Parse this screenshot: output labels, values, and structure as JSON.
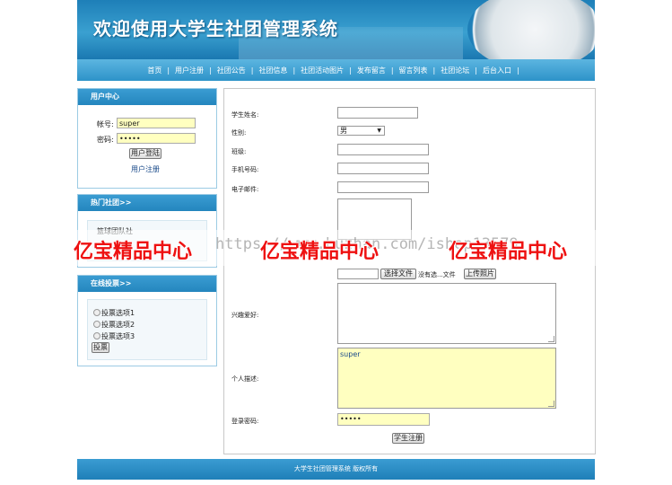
{
  "banner": {
    "title": "欢迎使用大学生社团管理系统"
  },
  "nav": {
    "items": [
      "首页",
      "用户注册",
      "社团公告",
      "社团信息",
      "社团活动图片",
      "发布留言",
      "留言列表",
      "社团论坛",
      "后台入口"
    ],
    "separator": "|"
  },
  "user_center": {
    "title": "用户中心",
    "account_label": "帐号:",
    "account_value": "super",
    "password_label": "密码:",
    "password_value": "•••••",
    "login_button": "用户登陆",
    "register_link": "用户注册"
  },
  "hot_clubs": {
    "title": "热门社团>>",
    "item": "篮球团队社"
  },
  "vote": {
    "title": "在线投票>>",
    "options": [
      "投票选项1",
      "投票选项2",
      "投票选项3"
    ],
    "submit": "投票"
  },
  "form": {
    "name_label": "学生姓名:",
    "gender_label": "性别:",
    "gender_value": "男",
    "class_label": "班级:",
    "phone_label": "手机号码:",
    "email_label": "电子邮件:",
    "choose_file": "选择文件",
    "no_file": "没有选...文件",
    "upload_photo": "上传照片",
    "hobby_label": "兴趣爱好:",
    "desc_label": "个人描述:",
    "desc_value": "super",
    "password_label": "登录密码:",
    "password_value": "•••••",
    "submit": "学生注册"
  },
  "watermark": {
    "text": "亿宝精品中心",
    "url": "https://www.huzhan.com/ishop13579"
  },
  "footer": {
    "text": "大学生社团管理系统 版权所有"
  }
}
